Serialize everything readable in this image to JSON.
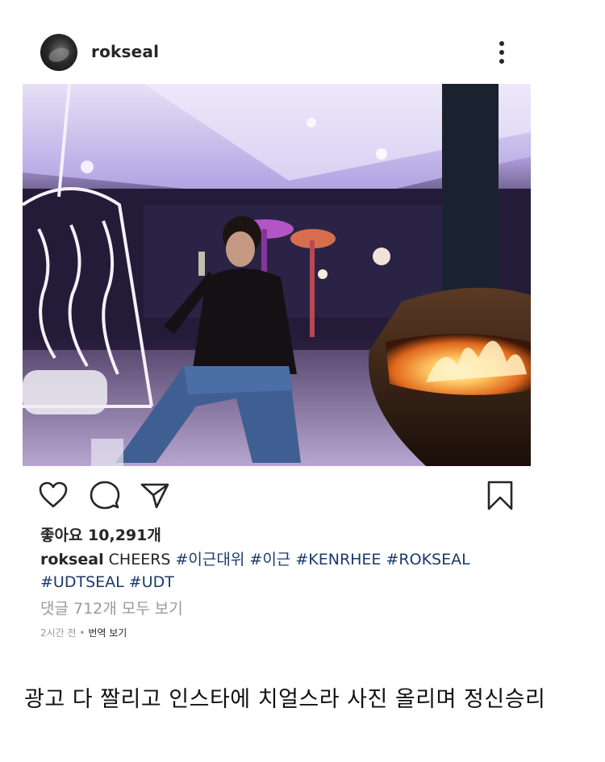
{
  "post": {
    "username": "rokseal",
    "more_icon": "more-vertical-icon",
    "photo_description_icon": "post-photo",
    "actions": {
      "like_icon": "heart-icon",
      "comment_icon": "comment-icon",
      "share_icon": "send-icon",
      "save_icon": "bookmark-icon"
    },
    "likes_text": "좋아요 10,291개",
    "caption": {
      "user": "rokseal",
      "text": "CHEERS",
      "tags_line1": [
        "#이근대위",
        "#이근",
        "#KENRHEE",
        "#ROKSEAL"
      ],
      "tags_line2": [
        "#UDTSEAL",
        "#UDT"
      ]
    },
    "comments_link": "댓글 712개 모두 보기",
    "time": "2시간 전",
    "separator": "•",
    "translate": "번역 보기"
  },
  "bottom_caption": "광고 다 짤리고 인스타에 치얼스라 사진 올리며 정신승리",
  "colors": {
    "text": "#262626",
    "muted": "#9a9a9a",
    "hashtag": "#1a3a6b"
  }
}
